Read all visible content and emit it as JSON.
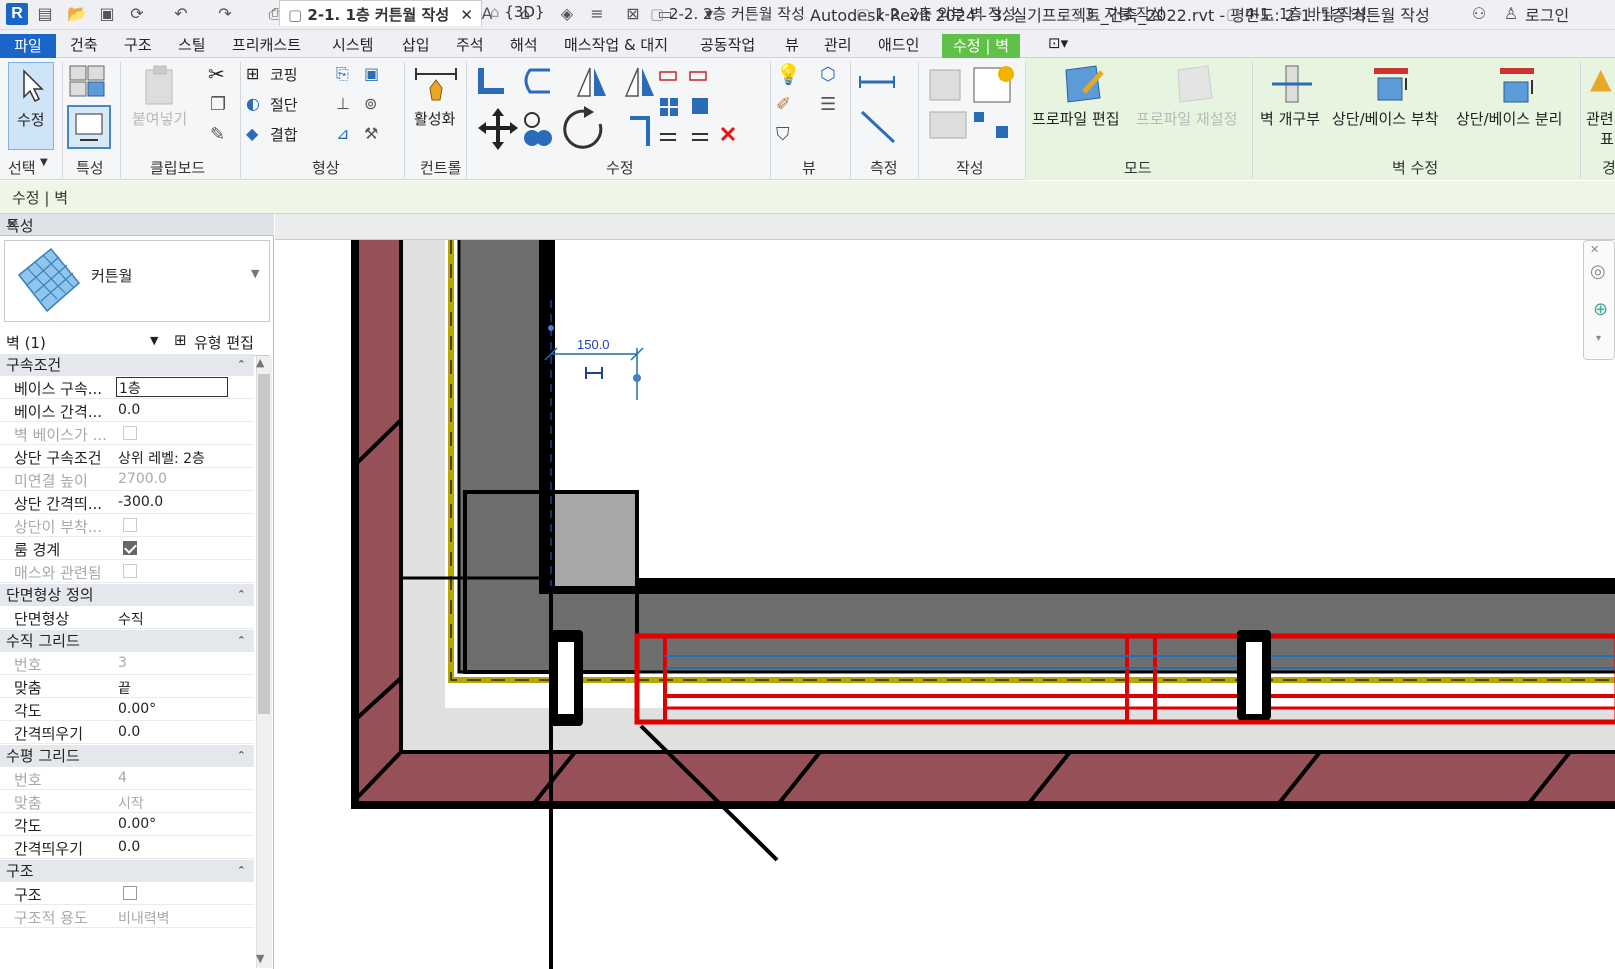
{
  "titlebar": {
    "title": "Autodesk Revit 2024 - 3. 실기프로젝트_건축_2022.rvt - 평면도: 2-1. 1층 커튼월 작성",
    "login": "로그인",
    "logo": "R"
  },
  "ribbon_tabs": [
    "파일",
    "건축",
    "구조",
    "스틸",
    "프리캐스트",
    "시스템",
    "삽입",
    "주석",
    "해석",
    "매스작업 & 대지",
    "공동작업",
    "뷰",
    "관리",
    "애드인",
    "수정 | 벽"
  ],
  "ribbon": {
    "modify_label": "수정",
    "paste_label": "붙여넣기",
    "cope_label": "코핑",
    "cut_label": "절단",
    "join_label": "결합",
    "activate_label": "활성화",
    "edit_profile_label": "프로파일 편집",
    "reset_profile_label": "프로파일 재설정",
    "wall_opening_label": "벽 개구부",
    "attach_label": "상단/베이스 부착",
    "detach_label": "상단/베이스 분리",
    "related_label": "관련",
    "related_sub": "표",
    "panels": [
      "선택",
      "특성",
      "클립보드",
      "형상",
      "컨트롤",
      "수정",
      "뷰",
      "측정",
      "작성",
      "모드",
      "벽 수정",
      "경"
    ]
  },
  "context_bar": {
    "text": "수정 | 벽"
  },
  "properties": {
    "header": "특성",
    "type_name": "커튼월",
    "selector": "벽 (1)",
    "edit_type": "유형 편집",
    "sections": {
      "constraints": "구속조건",
      "profile": "단면형상 정의",
      "vgrid": "수직 그리드",
      "hgrid": "수평 그리드",
      "structure": "구조"
    },
    "rows": {
      "base_constraint": {
        "k": "베이스 구속...",
        "v": "1층"
      },
      "base_offset": {
        "k": "베이스 간격...",
        "v": "0.0"
      },
      "base_attached": {
        "k": "벽 베이스가 ..."
      },
      "top_constraint": {
        "k": "상단 구속조건",
        "v": "상위 레벨: 2층"
      },
      "unconnected_height": {
        "k": "미연결 높이",
        "v": "2700.0"
      },
      "top_offset": {
        "k": "상단 간격띄...",
        "v": "-300.0"
      },
      "top_attached": {
        "k": "상단이 부착..."
      },
      "room_bounding": {
        "k": "룸 경계"
      },
      "related_mass": {
        "k": "매스와 관련됨"
      },
      "profile": {
        "k": "단면형상",
        "v": "수직"
      },
      "vgrid_number": {
        "k": "번호",
        "v": "3"
      },
      "vgrid_just": {
        "k": "맞춤",
        "v": "끝"
      },
      "vgrid_angle": {
        "k": "각도",
        "v": "0.00°"
      },
      "vgrid_offset": {
        "k": "간격띄우기",
        "v": "0.0"
      },
      "hgrid_number": {
        "k": "번호",
        "v": "4"
      },
      "hgrid_just": {
        "k": "맞춤",
        "v": "시작"
      },
      "hgrid_angle": {
        "k": "각도",
        "v": "0.00°"
      },
      "hgrid_offset": {
        "k": "간격띄우기",
        "v": "0.0"
      },
      "structural": {
        "k": "구조"
      },
      "structural_usage": {
        "k": "구조적 용도",
        "v": "비내력벽"
      }
    }
  },
  "view_tabs": [
    "2-1. 1층 커튼월 작성",
    "{3D}",
    "2-2. 2층 커튼월 작성",
    "1-2. 2층 외부 벽 작성",
    "3. 지붕 작성",
    "4-1. 1층 바닥 작성"
  ],
  "canvas": {
    "dimension": "150.0"
  },
  "colors": {
    "accent": "#1b64c8",
    "context_tab": "#60c148",
    "brick": "#955058",
    "highlight": "#e00000"
  }
}
